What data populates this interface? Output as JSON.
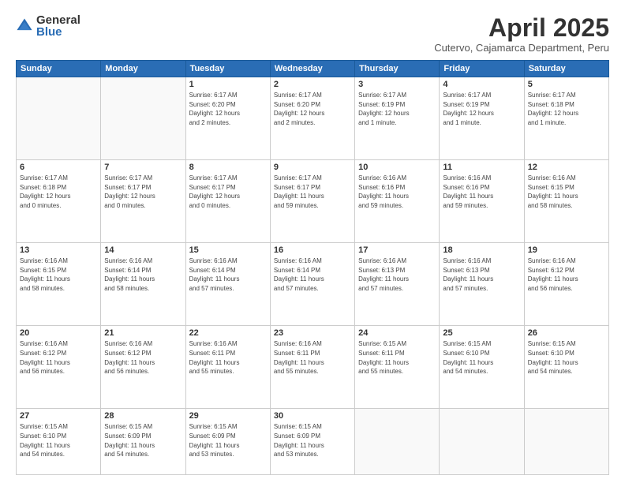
{
  "logo": {
    "general": "General",
    "blue": "Blue"
  },
  "header": {
    "month": "April 2025",
    "location": "Cutervo, Cajamarca Department, Peru"
  },
  "days_of_week": [
    "Sunday",
    "Monday",
    "Tuesday",
    "Wednesday",
    "Thursday",
    "Friday",
    "Saturday"
  ],
  "weeks": [
    [
      {
        "day": "",
        "detail": ""
      },
      {
        "day": "",
        "detail": ""
      },
      {
        "day": "1",
        "detail": "Sunrise: 6:17 AM\nSunset: 6:20 PM\nDaylight: 12 hours\nand 2 minutes."
      },
      {
        "day": "2",
        "detail": "Sunrise: 6:17 AM\nSunset: 6:20 PM\nDaylight: 12 hours\nand 2 minutes."
      },
      {
        "day": "3",
        "detail": "Sunrise: 6:17 AM\nSunset: 6:19 PM\nDaylight: 12 hours\nand 1 minute."
      },
      {
        "day": "4",
        "detail": "Sunrise: 6:17 AM\nSunset: 6:19 PM\nDaylight: 12 hours\nand 1 minute."
      },
      {
        "day": "5",
        "detail": "Sunrise: 6:17 AM\nSunset: 6:18 PM\nDaylight: 12 hours\nand 1 minute."
      }
    ],
    [
      {
        "day": "6",
        "detail": "Sunrise: 6:17 AM\nSunset: 6:18 PM\nDaylight: 12 hours\nand 0 minutes."
      },
      {
        "day": "7",
        "detail": "Sunrise: 6:17 AM\nSunset: 6:17 PM\nDaylight: 12 hours\nand 0 minutes."
      },
      {
        "day": "8",
        "detail": "Sunrise: 6:17 AM\nSunset: 6:17 PM\nDaylight: 12 hours\nand 0 minutes."
      },
      {
        "day": "9",
        "detail": "Sunrise: 6:17 AM\nSunset: 6:17 PM\nDaylight: 11 hours\nand 59 minutes."
      },
      {
        "day": "10",
        "detail": "Sunrise: 6:16 AM\nSunset: 6:16 PM\nDaylight: 11 hours\nand 59 minutes."
      },
      {
        "day": "11",
        "detail": "Sunrise: 6:16 AM\nSunset: 6:16 PM\nDaylight: 11 hours\nand 59 minutes."
      },
      {
        "day": "12",
        "detail": "Sunrise: 6:16 AM\nSunset: 6:15 PM\nDaylight: 11 hours\nand 58 minutes."
      }
    ],
    [
      {
        "day": "13",
        "detail": "Sunrise: 6:16 AM\nSunset: 6:15 PM\nDaylight: 11 hours\nand 58 minutes."
      },
      {
        "day": "14",
        "detail": "Sunrise: 6:16 AM\nSunset: 6:14 PM\nDaylight: 11 hours\nand 58 minutes."
      },
      {
        "day": "15",
        "detail": "Sunrise: 6:16 AM\nSunset: 6:14 PM\nDaylight: 11 hours\nand 57 minutes."
      },
      {
        "day": "16",
        "detail": "Sunrise: 6:16 AM\nSunset: 6:14 PM\nDaylight: 11 hours\nand 57 minutes."
      },
      {
        "day": "17",
        "detail": "Sunrise: 6:16 AM\nSunset: 6:13 PM\nDaylight: 11 hours\nand 57 minutes."
      },
      {
        "day": "18",
        "detail": "Sunrise: 6:16 AM\nSunset: 6:13 PM\nDaylight: 11 hours\nand 57 minutes."
      },
      {
        "day": "19",
        "detail": "Sunrise: 6:16 AM\nSunset: 6:12 PM\nDaylight: 11 hours\nand 56 minutes."
      }
    ],
    [
      {
        "day": "20",
        "detail": "Sunrise: 6:16 AM\nSunset: 6:12 PM\nDaylight: 11 hours\nand 56 minutes."
      },
      {
        "day": "21",
        "detail": "Sunrise: 6:16 AM\nSunset: 6:12 PM\nDaylight: 11 hours\nand 56 minutes."
      },
      {
        "day": "22",
        "detail": "Sunrise: 6:16 AM\nSunset: 6:11 PM\nDaylight: 11 hours\nand 55 minutes."
      },
      {
        "day": "23",
        "detail": "Sunrise: 6:16 AM\nSunset: 6:11 PM\nDaylight: 11 hours\nand 55 minutes."
      },
      {
        "day": "24",
        "detail": "Sunrise: 6:15 AM\nSunset: 6:11 PM\nDaylight: 11 hours\nand 55 minutes."
      },
      {
        "day": "25",
        "detail": "Sunrise: 6:15 AM\nSunset: 6:10 PM\nDaylight: 11 hours\nand 54 minutes."
      },
      {
        "day": "26",
        "detail": "Sunrise: 6:15 AM\nSunset: 6:10 PM\nDaylight: 11 hours\nand 54 minutes."
      }
    ],
    [
      {
        "day": "27",
        "detail": "Sunrise: 6:15 AM\nSunset: 6:10 PM\nDaylight: 11 hours\nand 54 minutes."
      },
      {
        "day": "28",
        "detail": "Sunrise: 6:15 AM\nSunset: 6:09 PM\nDaylight: 11 hours\nand 54 minutes."
      },
      {
        "day": "29",
        "detail": "Sunrise: 6:15 AM\nSunset: 6:09 PM\nDaylight: 11 hours\nand 53 minutes."
      },
      {
        "day": "30",
        "detail": "Sunrise: 6:15 AM\nSunset: 6:09 PM\nDaylight: 11 hours\nand 53 minutes."
      },
      {
        "day": "",
        "detail": ""
      },
      {
        "day": "",
        "detail": ""
      },
      {
        "day": "",
        "detail": ""
      }
    ]
  ]
}
